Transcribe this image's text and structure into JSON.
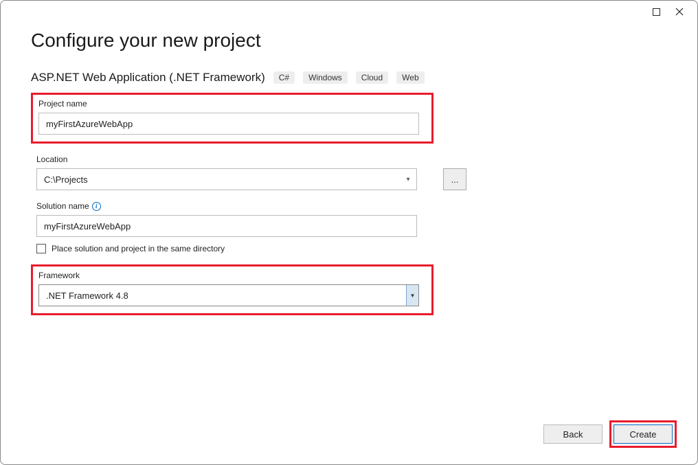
{
  "window": {
    "title": "Configure your new project"
  },
  "subtitle": "ASP.NET Web Application (.NET Framework)",
  "tags": [
    "C#",
    "Windows",
    "Cloud",
    "Web"
  ],
  "projectName": {
    "label": "Project name",
    "value": "myFirstAzureWebApp"
  },
  "location": {
    "label": "Location",
    "value": "C:\\Projects",
    "browse": "..."
  },
  "solutionName": {
    "label": "Solution name",
    "value": "myFirstAzureWebApp"
  },
  "sameDirCheckbox": {
    "label": "Place solution and project in the same directory",
    "checked": false
  },
  "framework": {
    "label": "Framework",
    "value": ".NET Framework 4.8"
  },
  "buttons": {
    "back": "Back",
    "create": "Create"
  }
}
